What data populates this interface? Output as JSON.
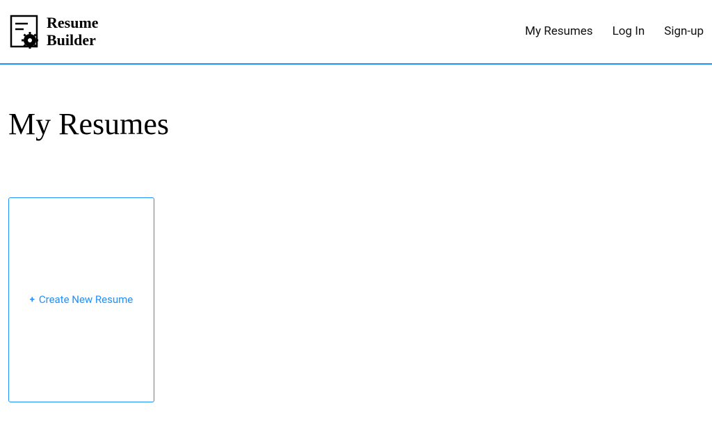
{
  "header": {
    "logo": {
      "line1": "Resume",
      "line2": "Builder"
    },
    "nav": {
      "my_resumes": "My Resumes",
      "log_in": "Log In",
      "sign_up": "Sign-up"
    }
  },
  "page": {
    "title": "My Resumes"
  },
  "card": {
    "create_label": "Create New Resume",
    "plus": "+"
  }
}
